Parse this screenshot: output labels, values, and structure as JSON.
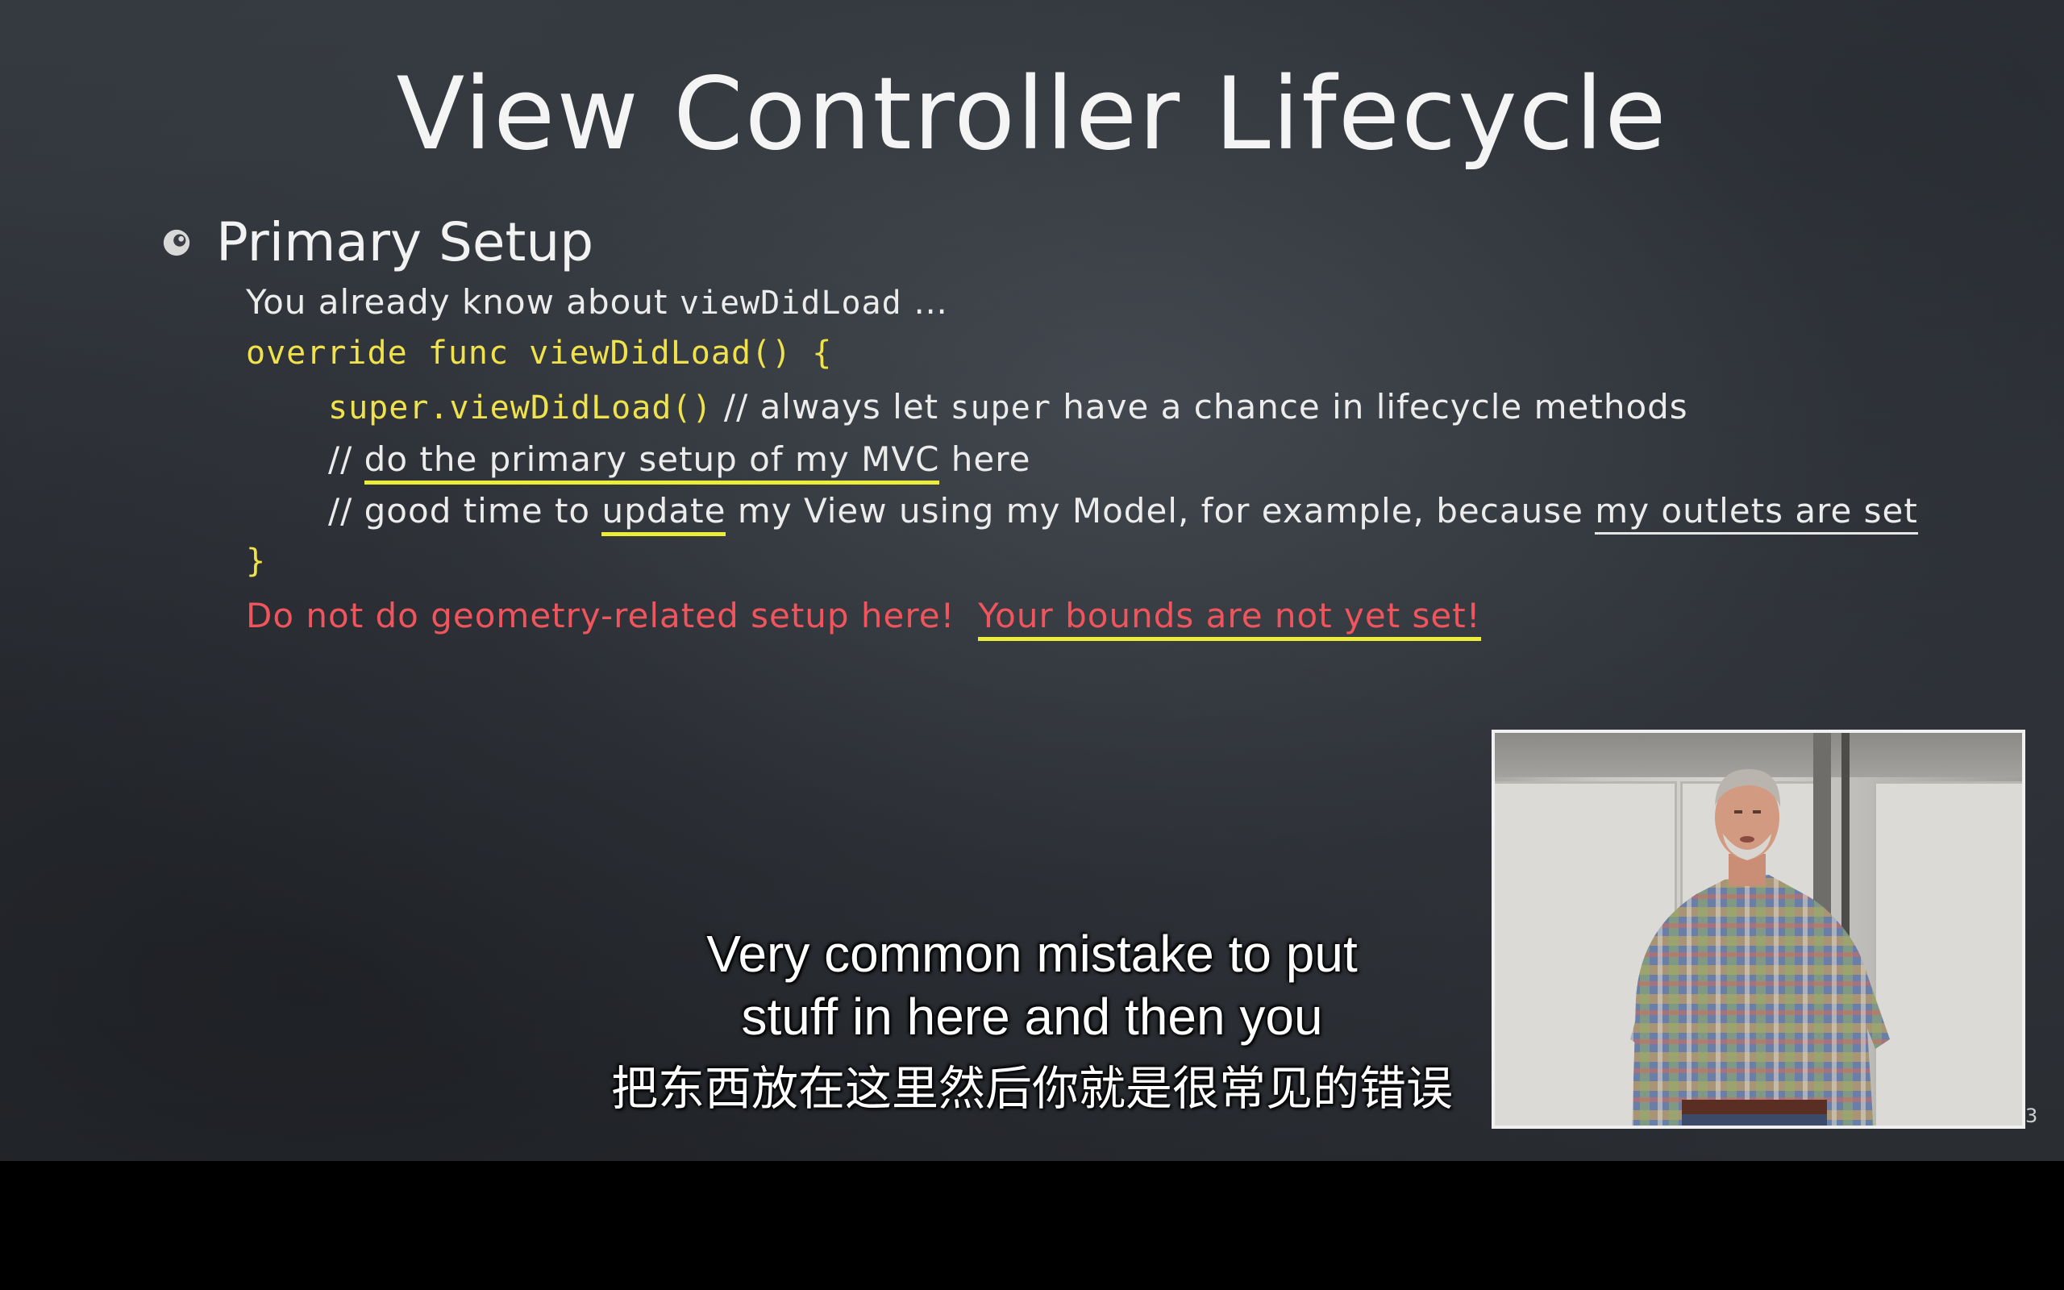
{
  "slide": {
    "title": "View Controller Lifecycle",
    "bullet": "Primary Setup",
    "line1_prefix": "You already know about ",
    "line1_code": "viewDidLoad",
    "line1_suffix": " …",
    "line2": "override func viewDidLoad() {",
    "line3_code": "super.viewDidLoad()",
    "line3_comment_a": " // always let ",
    "line3_comment_code": "super",
    "line3_comment_b": " have a chance in lifecycle methods",
    "line4_prefix": "// ",
    "line4_underlined": "do the primary setup of my MVC",
    "line4_suffix": " here",
    "line5_a": "// good time to ",
    "line5_ul1": "update",
    "line5_b": " my View using my Model, for example, because ",
    "line5_ul2": "my outlets are set",
    "line6": "}",
    "line7_a": "Do not do geometry-related setup here!  ",
    "line7_ul": "Your bounds are not yet set!",
    "page_number": "3"
  },
  "subtitles": {
    "line1": "Very common mistake to put",
    "line2": "stuff in here and then you",
    "line3": "把东西放在这里然后你就是很常见的错误"
  },
  "colors": {
    "chalkboard": "#2f3338",
    "code_yellow": "#f0e24a",
    "warning_red": "#f0545c",
    "underline_yellow": "#ecec3a"
  }
}
